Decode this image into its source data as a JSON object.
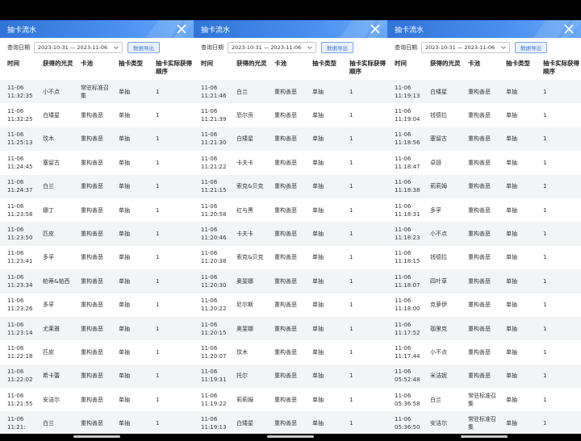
{
  "panels": [
    {
      "title": "抽卡流水",
      "query_label": "查询日期",
      "date_range": "2023-10-31 — 2023-11-06",
      "export_label": "数据导出",
      "columns": [
        "时间",
        "获得的光灵",
        "卡池",
        "抽卡类型",
        "抽卡实际获得顺序"
      ],
      "rows": [
        [
          "11-06 11:32:35",
          "小不点",
          "常驻标准召集",
          "单抽",
          "1"
        ],
        [
          "11-06 11:32:25",
          "白矮星",
          "重构善恶",
          "单抽",
          "1"
        ],
        [
          "11-06 11:25:13",
          "玟木",
          "重构善恶",
          "单抽",
          "1"
        ],
        [
          "11-06 11:24:45",
          "塞留古",
          "重构善恶",
          "单抽",
          "1"
        ],
        [
          "11-06 11:24:37",
          "白兰",
          "重构善恶",
          "单抽",
          "1"
        ],
        [
          "11-06 11:23:58",
          "娜丁",
          "重构善恶",
          "单抽",
          "1"
        ],
        [
          "11-06 11:23:50",
          "匹皮",
          "重构善恶",
          "单抽",
          "1"
        ],
        [
          "11-06 11:23:41",
          "多孚",
          "重构善恶",
          "单抽",
          "1"
        ],
        [
          "11-06 11:23:34",
          "帕蒂&帕西",
          "重构善恶",
          "单抽",
          "1"
        ],
        [
          "11-06 11:23:26",
          "多孚",
          "重构善恶",
          "单抽",
          "1"
        ],
        [
          "11-06 11:23:14",
          "尤莱雅",
          "重构善恶",
          "单抽",
          "1"
        ],
        [
          "11-06 11:22:18",
          "匹皮",
          "重构善恶",
          "单抽",
          "1"
        ],
        [
          "11-06 11:22:02",
          "希卡蕾",
          "重构善恶",
          "单抽",
          "1"
        ],
        [
          "11-06 11:21:55",
          "安洁尔",
          "重构善恶",
          "单抽",
          "1"
        ],
        [
          "11-06 11:21:",
          "白兰",
          "重构善恶",
          "单抽",
          "1"
        ]
      ]
    },
    {
      "title": "抽卡流水",
      "query_label": "查询日期",
      "date_range": "2023-10-31 — 2023-11-06",
      "export_label": "数据导出",
      "columns": [
        "时间",
        "获得的光灵",
        "卡池",
        "抽卡类型",
        "抽卡实际获得顺序"
      ],
      "rows": [
        [
          "11-06 11:21:46",
          "白兰",
          "重构善恶",
          "单抽",
          "1"
        ],
        [
          "11-06 11:21:39",
          "恐尔贡",
          "重构善恶",
          "单抽",
          "1"
        ],
        [
          "11-06 11:21:30",
          "白矮星",
          "重构善恶",
          "单抽",
          "1"
        ],
        [
          "11-06 11:21:22",
          "卡夫卡",
          "重构善恶",
          "单抽",
          "1"
        ],
        [
          "11-06 11:21:15",
          "索克&贝克",
          "重构善恶",
          "单抽",
          "1"
        ],
        [
          "11-06 11:20:58",
          "红与黑",
          "重构善恶",
          "单抽",
          "1"
        ],
        [
          "11-06 11:20:46",
          "卡夫卡",
          "重构善恶",
          "单抽",
          "1"
        ],
        [
          "11-06 11:20:38",
          "索克&贝克",
          "重构善恶",
          "单抽",
          "1"
        ],
        [
          "11-06 11:20:30",
          "奥斐娜",
          "重构善恶",
          "单抽",
          "1"
        ],
        [
          "11-06 11:20:22",
          "尼尔斯",
          "重构善恶",
          "单抽",
          "1"
        ],
        [
          "11-06 11:20:15",
          "奥斐娜",
          "重构善恶",
          "单抽",
          "1"
        ],
        [
          "11-06 11:20:07",
          "玟木",
          "重构善恶",
          "单抽",
          "1"
        ],
        [
          "11-06 11:19:31",
          "托尔",
          "重构善恶",
          "单抽",
          "1"
        ],
        [
          "11-06 11:19:22",
          "莉莉姆",
          "重构善恶",
          "单抽",
          "1"
        ],
        [
          "11-06 11:19:13",
          "白矮星",
          "重构善恶",
          "单抽",
          "1"
        ]
      ]
    },
    {
      "title": "抽卡流水",
      "query_label": "查询日期",
      "date_range": "2023-10-31 — 2023-11-06",
      "export_label": "数据导出",
      "columns": [
        "时间",
        "获得的光灵",
        "卡池",
        "抽卡类型",
        "抽卡实际获得顺序"
      ],
      "rows": [
        [
          "11-06 11:19:13",
          "白矮星",
          "重构善恶",
          "单抽",
          "1"
        ],
        [
          "11-06 11:19:04",
          "钱德拉",
          "重构善恶",
          "单抽",
          "1"
        ],
        [
          "11-06 11:18:56",
          "塞留古",
          "重构善恶",
          "单抽",
          "1"
        ],
        [
          "11-06 11:18:47",
          "卓娅",
          "重构善恶",
          "单抽",
          "1"
        ],
        [
          "11-06 11:18:38",
          "莉莉姆",
          "重构善恶",
          "单抽",
          "1"
        ],
        [
          "11-06 11:18:31",
          "多孚",
          "重构善恶",
          "单抽",
          "1"
        ],
        [
          "11-06 11:18:23",
          "小不点",
          "重构善恶",
          "单抽",
          "1"
        ],
        [
          "11-06 11:18:15",
          "钱德拉",
          "重构善恶",
          "单抽",
          "1"
        ],
        [
          "11-06 11:18:07",
          "四叶草",
          "重构善恶",
          "单抽",
          "1"
        ],
        [
          "11-06 11:18:00",
          "克萝伊",
          "重构善恶",
          "单抽",
          "1"
        ],
        [
          "11-06 11:17:52",
          "珈里克",
          "重构善恶",
          "单抽",
          "1"
        ],
        [
          "11-06 11:17:44",
          "小不点",
          "重构善恶",
          "单抽",
          "1"
        ],
        [
          "11-06 05:52:48",
          "米洁妮",
          "重构善恶",
          "单抽",
          "1"
        ],
        [
          "11-06 05:36:58",
          "白兰",
          "常驻标准召集",
          "单抽",
          "1"
        ],
        [
          "11-06 05:36:50",
          "安洁尔",
          "常驻标准召集",
          "单抽",
          "1"
        ]
      ]
    }
  ],
  "colors": {
    "titlebar": "#2f74d6",
    "export_border": "#7aa6e6",
    "export_text": "#3a78d8",
    "row_stripe": "#f3f4f6"
  },
  "icons": {
    "close": "close-icon",
    "caret": "chevron-down-icon"
  }
}
